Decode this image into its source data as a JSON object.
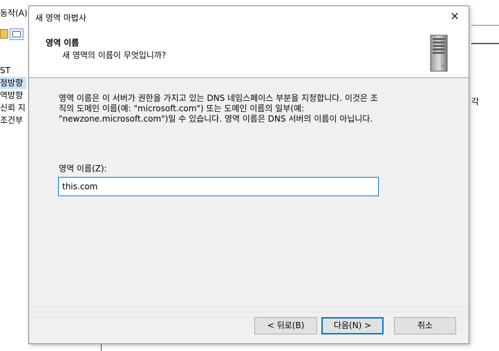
{
  "background": {
    "menu_action": "동작(A)",
    "tree_items": [
      "ST",
      "정방향",
      "역방향",
      "신뢰 지",
      "조건부"
    ],
    "right_fragment": "각"
  },
  "dialog": {
    "title": "새 영역 마법사",
    "close_glyph": "✕",
    "header": {
      "title": "영역 이름",
      "subtitle": "새 영역의 이름이 무엇입니까?"
    },
    "description_lines": [
      "영역 이름은 이 서버가 권한을 가지고 있는 DNS 네임스페이스 부분을 지정합니다. 이것은 조",
      "직의 도메인 이름(예: \"microsoft.com\") 또는 도메인 이름의 일부(예:",
      "\"newzone.microsoft.com\")일 수 있습니다. 영역 이름은 DNS 서버의 이름이 아닙니다."
    ],
    "zone_name": {
      "label": "영역 이름(Z):",
      "value": "this.com"
    },
    "buttons": {
      "back": "< 뒤로(B)",
      "next": "다음(N) >",
      "cancel": "취소"
    }
  }
}
